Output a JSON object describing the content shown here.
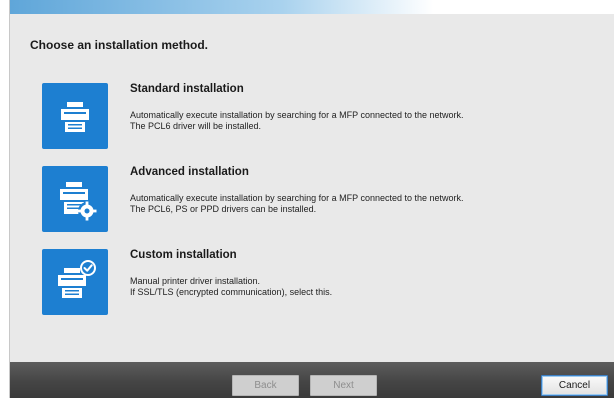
{
  "heading": "Choose an installation method.",
  "options": [
    {
      "title": "Standard installation",
      "description": [
        "Automatically execute installation by searching for a MFP connected to the network.",
        "The PCL6 driver will be installed."
      ],
      "icon": "printer-icon"
    },
    {
      "title": "Advanced installation",
      "description": [
        "Automatically execute installation by searching for a MFP connected to the network.",
        "The PCL6, PS or PPD drivers can be installed."
      ],
      "icon": "printer-settings-icon"
    },
    {
      "title": "Custom installation",
      "description": [
        "Manual printer driver installation.",
        "If SSL/TLS (encrypted communication), select this."
      ],
      "icon": "printer-check-icon"
    }
  ],
  "footer": {
    "back_label": "Back",
    "next_label": "Next",
    "cancel_label": "Cancel"
  },
  "colors": {
    "accent": "#1d7fd1",
    "footer": "#474747",
    "background": "#e9e9e9"
  }
}
